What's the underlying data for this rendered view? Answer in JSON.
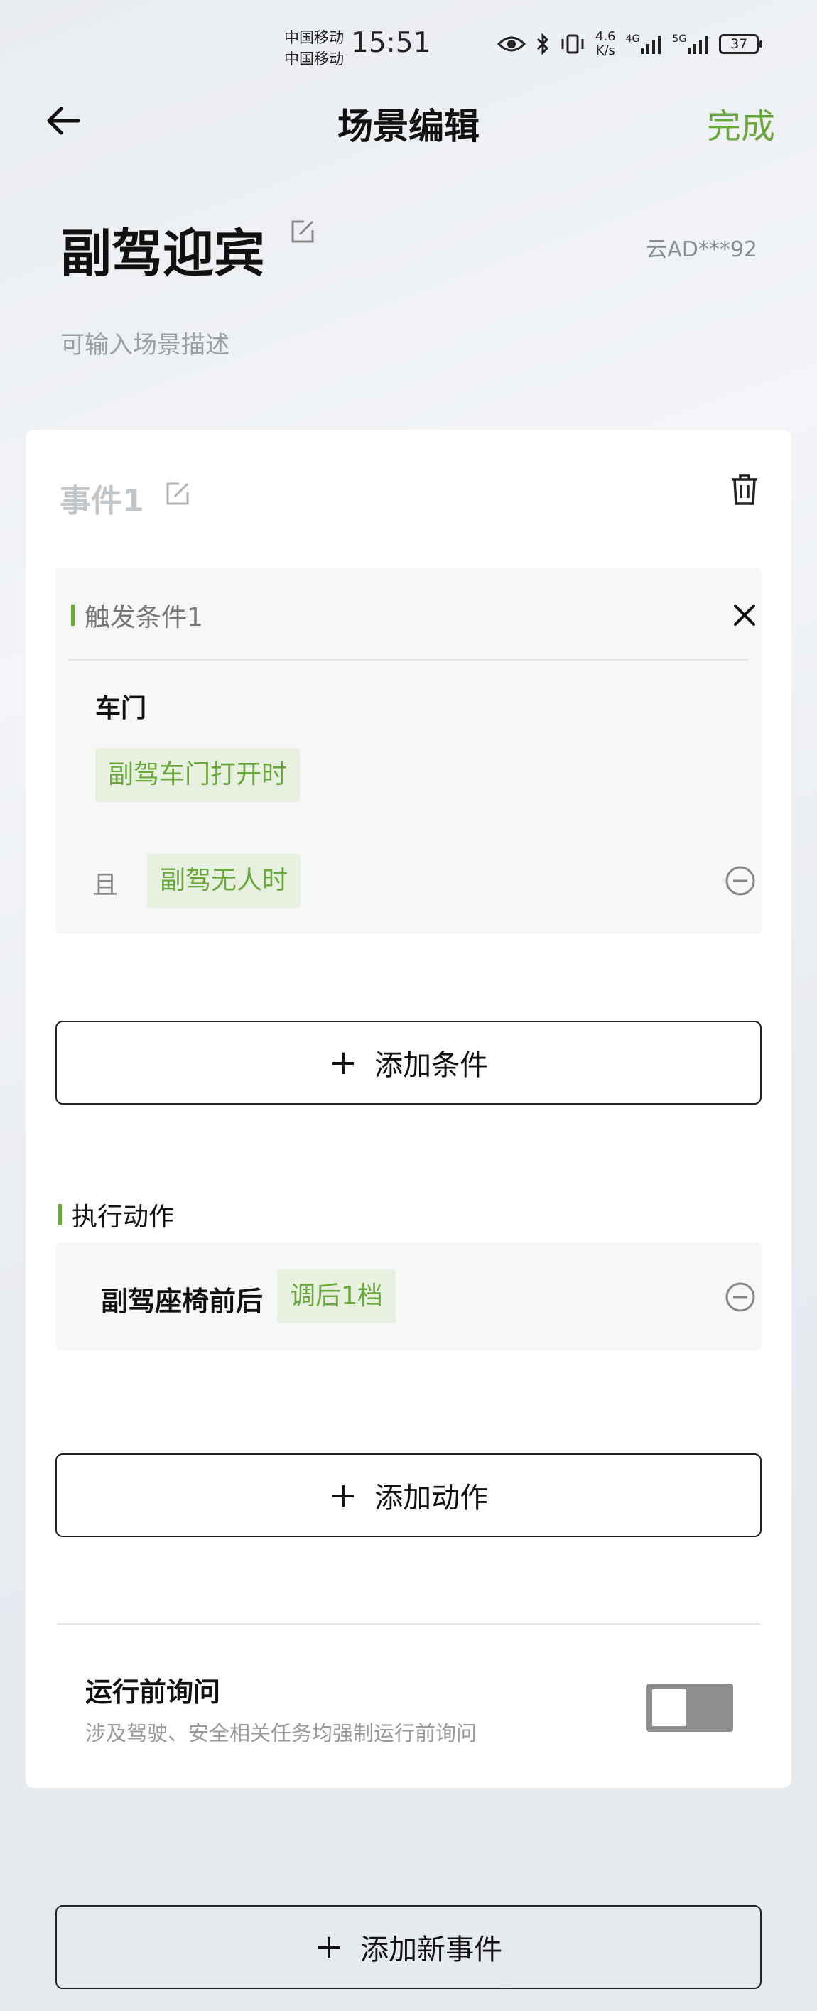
{
  "status_bar": {
    "carrier_1": "中国移动",
    "carrier_2": "中国移动",
    "time": "15:51",
    "net_speed_value": "4.6",
    "net_speed_unit": "K/s",
    "signal_1": "4G",
    "signal_2": "5G",
    "battery": "37"
  },
  "header": {
    "title": "场景编辑",
    "done_label": "完成"
  },
  "scene": {
    "name": "副驾迎宾",
    "plate": "云AD***92",
    "description_placeholder": "可输入场景描述"
  },
  "event": {
    "title": "事件1",
    "trigger": {
      "label": "触发条件1",
      "device": "车门",
      "condition": "副驾车门打开时",
      "and_label": "且",
      "and_condition": "副驾无人时"
    },
    "add_condition_label": "添加条件",
    "action_section_label": "执行动作",
    "action": {
      "name": "副驾座椅前后",
      "value": "调后1档"
    },
    "add_action_label": "添加动作",
    "ask_before_run": {
      "title": "运行前询问",
      "subtitle": "涉及驾驶、安全相关任务均强制运行前询问",
      "enabled": false
    }
  },
  "add_event_label": "添加新事件",
  "colors": {
    "accent": "#6aa83e",
    "chip_bg": "#e8f1e0",
    "toggle_off": "#8e8e8e"
  }
}
